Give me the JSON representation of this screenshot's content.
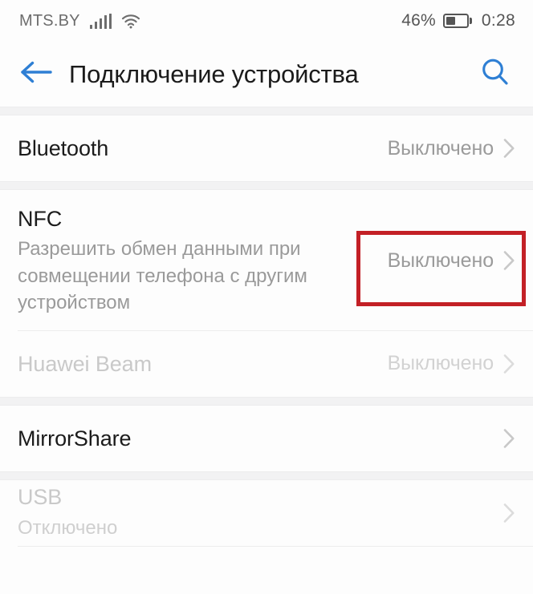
{
  "statusbar": {
    "carrier": "MTS.BY",
    "signal_icon": "signal-bars-icon",
    "wifi_icon": "wifi-icon",
    "battery_percent": "46%",
    "battery_level": 46,
    "battery_icon": "battery-icon",
    "clock": "0:28"
  },
  "header": {
    "back_icon": "arrow-left-icon",
    "title": "Подключение устройства",
    "search_icon": "search-icon",
    "accent_color": "#2e7fd4"
  },
  "annotation": {
    "color": "#c32026",
    "target": "nfc-status-value"
  },
  "sections": [
    {
      "rows": [
        {
          "name": "bluetooth",
          "title": "Bluetooth",
          "subtitle": "",
          "value": "Выключено",
          "disabled": false
        }
      ]
    },
    {
      "rows": [
        {
          "name": "nfc",
          "title": "NFC",
          "subtitle": "Разрешить обмен данными при совмещении телефона с другим устройством",
          "value": "Выключено",
          "disabled": false,
          "highlighted": true
        },
        {
          "name": "huawei-beam",
          "title": "Huawei Beam",
          "subtitle": "",
          "value": "Выключено",
          "disabled": true
        }
      ]
    },
    {
      "rows": [
        {
          "name": "mirrorshare",
          "title": "MirrorShare",
          "subtitle": "",
          "value": "",
          "disabled": false
        }
      ]
    },
    {
      "rows": [
        {
          "name": "usb",
          "title": "USB",
          "subtitle": "Отключено",
          "value": "",
          "disabled": true
        }
      ]
    }
  ]
}
